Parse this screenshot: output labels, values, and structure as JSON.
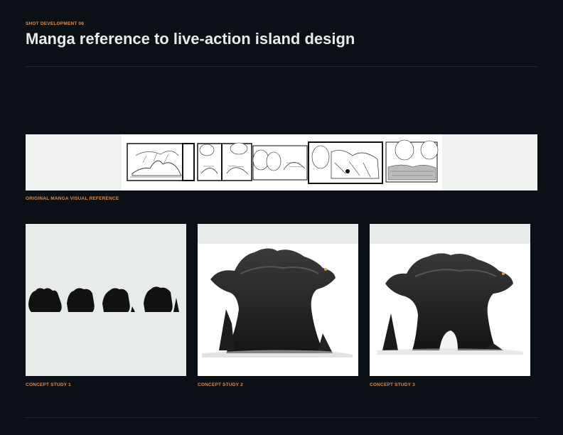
{
  "header": {
    "eyebrow": "SHOT DEVELOPMENT 06",
    "title": "Manga reference to live-action island design"
  },
  "reference": {
    "caption": "ORIGINAL MANGA VISUAL REFERENCE"
  },
  "concepts": [
    {
      "caption": "CONCEPT STUDY 1"
    },
    {
      "caption": "CONCEPT STUDY 2"
    },
    {
      "caption": "CONCEPT STUDY 3"
    }
  ],
  "colors": {
    "background": "#0b1016",
    "accent": "#e08a4a",
    "title": "#e8eaec",
    "divider": "#1f2b31"
  }
}
